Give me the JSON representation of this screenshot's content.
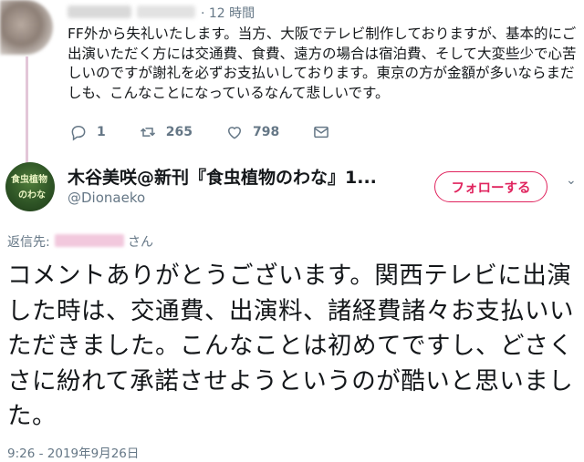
{
  "parent_tweet": {
    "time": "· 12 時間",
    "text": "FF外から失礼いたします。当方、大阪でテレビ制作しておりますが、基本的にご出演いただく方には交通費、食費、遠方の場合は宿泊費、そして大変些少で心苦しいのですが謝礼を必ずお支払いしております。東京の方が金額が多いならまだしも、こんなことになっているなんて悲しいです。",
    "reply_count": "1",
    "retweet_count": "265",
    "like_count": "798"
  },
  "tweet": {
    "avatar_text_line1": "食虫植物",
    "avatar_text_line2": "のわな",
    "display_name": "木谷美咲@新刊『食虫植物のわな』1...",
    "handle": "@Dionaeko",
    "follow_label": "フォローする",
    "reply_to_prefix": "返信先:",
    "reply_to_suffix": "さん",
    "text": "コメントありがとうございます。関西テレビに出演した時は、交通費、出演料、諸経費諸々お支払いいただきました。こんなことは初めてですし、どさくさに紛れて承諾させようというのが酷いと思いました。",
    "timestamp": "9:26 - 2019年9月26日"
  },
  "colors": {
    "accent": "#e0245e",
    "secondary_text": "#657786",
    "primary_text": "#14171a"
  }
}
